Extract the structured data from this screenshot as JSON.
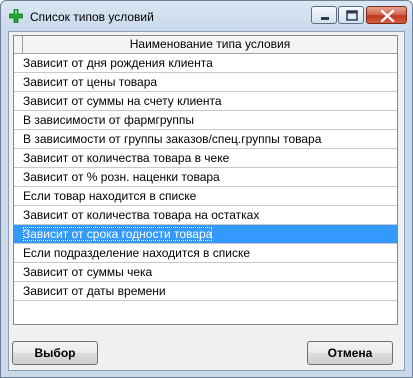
{
  "window": {
    "title": "Список типов условий"
  },
  "grid": {
    "column_header": "Наименование типа условия",
    "rows": [
      "Зависит от дня рождения клиента",
      "Зависит от цены товара",
      "Зависит от суммы на счету клиента",
      "В зависимости от фармгруппы",
      "В зависимости от группы заказов/спец.группы товара",
      "Зависит от количества товара в чеке",
      "Зависит от % розн. наценки товара",
      "Если товар находится в списке",
      "Зависит от количества товара на остатках",
      "Зависит от срока годности товара",
      "Если подразделение находится в списке",
      "Зависит от суммы чека",
      "Зависит от даты времени"
    ],
    "selected_index": 9,
    "selection_color": "#3399ff"
  },
  "buttons": {
    "select_label": "Выбор",
    "cancel_label": "Отмена"
  },
  "icons": {
    "app": "green-cross-icon",
    "minimize": "minimize-icon",
    "maximize": "maximize-icon",
    "close": "close-icon"
  }
}
